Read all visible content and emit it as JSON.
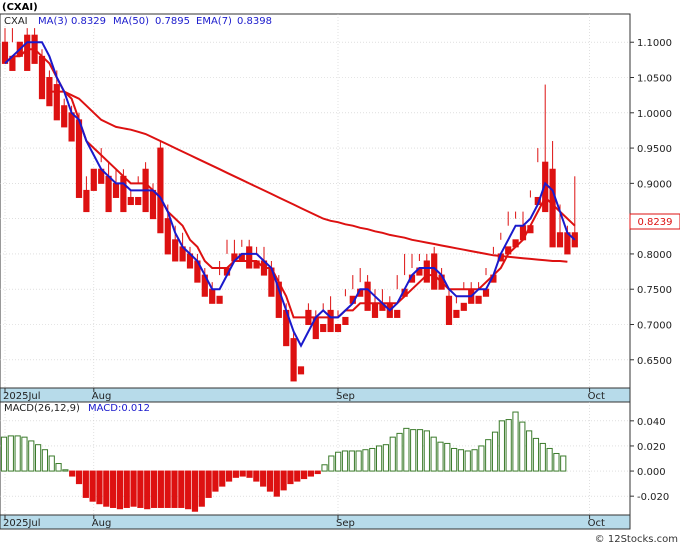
{
  "chart_data": [
    {
      "type": "candlestick",
      "title": "(CXAI)",
      "legend": [
        {
          "label": "CXAI",
          "color": "#222222"
        },
        {
          "label": "MA(3)",
          "value": "0.8329",
          "color": "#1a1acc"
        },
        {
          "label": "MA(50)",
          "value": "0.7895",
          "color": "#1a1acc"
        },
        {
          "label": "EMA(7)",
          "value": "0.8398",
          "color": "#1a1acc"
        }
      ],
      "last_price": "0.8239",
      "ylim": [
        0.61,
        1.14
      ],
      "yticks": [
        {
          "v": 1.1,
          "label": "1.1000"
        },
        {
          "v": 1.05,
          "label": "1.0500"
        },
        {
          "v": 1.0,
          "label": "1.0000"
        },
        {
          "v": 0.95,
          "label": "0.9500"
        },
        {
          "v": 0.9,
          "label": "0.9000"
        },
        {
          "v": 0.85,
          "label": "0.8500"
        },
        {
          "v": 0.8,
          "label": "0.8000"
        },
        {
          "v": 0.75,
          "label": "0.7500"
        },
        {
          "v": 0.7,
          "label": "0.7000"
        },
        {
          "v": 0.65,
          "label": "0.6500"
        }
      ],
      "xlabels": [
        {
          "i": 0,
          "label": "2025Jul"
        },
        {
          "i": 12,
          "label": "Aug"
        },
        {
          "i": 45,
          "label": "Sep"
        },
        {
          "i": 79,
          "label": "Oct"
        }
      ],
      "candles": [
        [
          1.1,
          1.12,
          1.08,
          1.07
        ],
        [
          1.08,
          1.12,
          1.1,
          1.06
        ],
        [
          1.1,
          1.11,
          1.11,
          1.08
        ],
        [
          1.11,
          1.12,
          1.08,
          1.06
        ],
        [
          1.11,
          1.12,
          1.08,
          1.07
        ],
        [
          1.08,
          1.09,
          1.03,
          1.02
        ],
        [
          1.05,
          1.06,
          1.02,
          1.01
        ],
        [
          1.04,
          1.06,
          1.0,
          0.99
        ],
        [
          1.01,
          1.02,
          0.99,
          0.98
        ],
        [
          1.0,
          1.01,
          0.98,
          0.96
        ],
        [
          0.99,
          1.0,
          0.89,
          0.88
        ],
        [
          0.89,
          0.91,
          0.89,
          0.86
        ],
        [
          0.92,
          0.93,
          0.93,
          0.89
        ],
        [
          0.92,
          0.95,
          0.93,
          0.9
        ],
        [
          0.91,
          0.93,
          0.89,
          0.86
        ],
        [
          0.9,
          0.92,
          0.9,
          0.88
        ],
        [
          0.91,
          0.92,
          0.87,
          0.86
        ],
        [
          0.88,
          0.89,
          0.88,
          0.87
        ],
        [
          0.88,
          0.91,
          0.9,
          0.87
        ],
        [
          0.92,
          0.93,
          0.89,
          0.86
        ],
        [
          0.89,
          0.9,
          0.87,
          0.85
        ],
        [
          0.95,
          0.96,
          0.84,
          0.83
        ],
        [
          0.85,
          0.87,
          0.81,
          0.8
        ],
        [
          0.82,
          0.84,
          0.8,
          0.79
        ],
        [
          0.81,
          0.83,
          0.8,
          0.79
        ],
        [
          0.8,
          0.81,
          0.79,
          0.78
        ],
        [
          0.79,
          0.8,
          0.77,
          0.76
        ],
        [
          0.77,
          0.78,
          0.75,
          0.74
        ],
        [
          0.75,
          0.76,
          0.74,
          0.73
        ],
        [
          0.74,
          0.79,
          0.77,
          0.73
        ],
        [
          0.78,
          0.82,
          0.8,
          0.77
        ],
        [
          0.8,
          0.82,
          0.8,
          0.79
        ],
        [
          0.8,
          0.82,
          0.81,
          0.79
        ],
        [
          0.81,
          0.82,
          0.79,
          0.78
        ],
        [
          0.79,
          0.81,
          0.8,
          0.78
        ],
        [
          0.79,
          0.81,
          0.78,
          0.77
        ],
        [
          0.78,
          0.79,
          0.75,
          0.74
        ],
        [
          0.76,
          0.77,
          0.72,
          0.71
        ],
        [
          0.72,
          0.73,
          0.68,
          0.67
        ],
        [
          0.68,
          0.69,
          0.63,
          0.62
        ],
        [
          0.64,
          0.72,
          0.72,
          0.63
        ],
        [
          0.72,
          0.73,
          0.71,
          0.7
        ],
        [
          0.71,
          0.72,
          0.69,
          0.68
        ],
        [
          0.7,
          0.73,
          0.72,
          0.69
        ],
        [
          0.72,
          0.74,
          0.7,
          0.69
        ],
        [
          0.7,
          0.72,
          0.71,
          0.69
        ],
        [
          0.71,
          0.75,
          0.74,
          0.7
        ],
        [
          0.74,
          0.77,
          0.75,
          0.73
        ],
        [
          0.75,
          0.78,
          0.76,
          0.74
        ],
        [
          0.76,
          0.77,
          0.73,
          0.72
        ],
        [
          0.73,
          0.75,
          0.72,
          0.71
        ],
        [
          0.73,
          0.75,
          0.73,
          0.72
        ],
        [
          0.73,
          0.74,
          0.72,
          0.71
        ],
        [
          0.72,
          0.77,
          0.75,
          0.71
        ],
        [
          0.75,
          0.8,
          0.77,
          0.74
        ],
        [
          0.77,
          0.8,
          0.78,
          0.76
        ],
        [
          0.78,
          0.8,
          0.79,
          0.77
        ],
        [
          0.79,
          0.8,
          0.78,
          0.76
        ],
        [
          0.8,
          0.81,
          0.76,
          0.75
        ],
        [
          0.77,
          0.78,
          0.76,
          0.75
        ],
        [
          0.74,
          0.75,
          0.72,
          0.7
        ],
        [
          0.72,
          0.74,
          0.73,
          0.71
        ],
        [
          0.73,
          0.76,
          0.75,
          0.72
        ],
        [
          0.75,
          0.76,
          0.74,
          0.73
        ],
        [
          0.74,
          0.76,
          0.75,
          0.73
        ],
        [
          0.75,
          0.78,
          0.77,
          0.74
        ],
        [
          0.77,
          0.81,
          0.8,
          0.76
        ],
        [
          0.8,
          0.83,
          0.82,
          0.79
        ],
        [
          0.81,
          0.86,
          0.84,
          0.8
        ],
        [
          0.82,
          0.86,
          0.85,
          0.81
        ],
        [
          0.84,
          0.86,
          0.83,
          0.82
        ],
        [
          0.84,
          0.89,
          0.88,
          0.83
        ],
        [
          0.88,
          0.95,
          0.93,
          0.87
        ],
        [
          0.93,
          1.04,
          0.91,
          0.86
        ],
        [
          0.92,
          0.96,
          0.83,
          0.81
        ],
        [
          0.83,
          0.87,
          0.83,
          0.81
        ],
        [
          0.83,
          0.84,
          0.82,
          0.8
        ],
        [
          0.83,
          0.91,
          0.82,
          0.81
        ]
      ],
      "ma3": [
        1.07,
        1.08,
        1.09,
        1.1,
        1.1,
        1.1,
        1.08,
        1.05,
        1.03,
        1.0,
        0.99,
        0.96,
        0.94,
        0.92,
        0.91,
        0.9,
        0.9,
        0.89,
        0.89,
        0.89,
        0.89,
        0.88,
        0.86,
        0.83,
        0.81,
        0.8,
        0.79,
        0.77,
        0.75,
        0.75,
        0.77,
        0.79,
        0.8,
        0.8,
        0.8,
        0.79,
        0.78,
        0.75,
        0.72,
        0.69,
        0.67,
        0.69,
        0.71,
        0.72,
        0.71,
        0.71,
        0.72,
        0.73,
        0.75,
        0.75,
        0.74,
        0.73,
        0.72,
        0.73,
        0.75,
        0.77,
        0.78,
        0.78,
        0.78,
        0.77,
        0.75,
        0.74,
        0.74,
        0.74,
        0.75,
        0.75,
        0.77,
        0.8,
        0.82,
        0.84,
        0.84,
        0.85,
        0.87,
        0.9,
        0.89,
        0.86,
        0.83,
        0.82
      ],
      "ema7": [
        1.07,
        1.08,
        1.08,
        1.09,
        1.09,
        1.08,
        1.07,
        1.05,
        1.03,
        1.02,
        0.99,
        0.96,
        0.95,
        0.94,
        0.93,
        0.92,
        0.91,
        0.9,
        0.9,
        0.9,
        0.89,
        0.88,
        0.86,
        0.85,
        0.84,
        0.82,
        0.81,
        0.79,
        0.78,
        0.78,
        0.78,
        0.79,
        0.79,
        0.79,
        0.79,
        0.78,
        0.78,
        0.76,
        0.74,
        0.71,
        0.71,
        0.71,
        0.71,
        0.71,
        0.71,
        0.71,
        0.72,
        0.72,
        0.73,
        0.73,
        0.73,
        0.73,
        0.73,
        0.73,
        0.74,
        0.75,
        0.76,
        0.77,
        0.77,
        0.76,
        0.75,
        0.75,
        0.75,
        0.75,
        0.75,
        0.76,
        0.77,
        0.78,
        0.8,
        0.81,
        0.82,
        0.84,
        0.86,
        0.88,
        0.87,
        0.86,
        0.85,
        0.84
      ],
      "ma50": [
        1.03,
        1.03,
        1.03,
        1.025,
        1.02,
        1.01,
        1.0,
        0.99,
        0.985,
        0.98,
        0.978,
        0.976,
        0.973,
        0.97,
        0.965,
        0.96,
        0.955,
        0.95,
        0.945,
        0.94,
        0.935,
        0.93,
        0.925,
        0.92,
        0.915,
        0.91,
        0.905,
        0.9,
        0.895,
        0.89,
        0.885,
        0.88,
        0.875,
        0.87,
        0.865,
        0.86,
        0.855,
        0.85,
        0.847,
        0.845,
        0.842,
        0.84,
        0.837,
        0.835,
        0.832,
        0.83,
        0.827,
        0.825,
        0.823,
        0.82,
        0.818,
        0.816,
        0.814,
        0.812,
        0.81,
        0.808,
        0.806,
        0.804,
        0.802,
        0.8,
        0.798,
        0.797,
        0.796,
        0.795,
        0.794,
        0.793,
        0.792,
        0.791,
        0.79,
        0.79,
        0.789
      ],
      "ma50_offset": 7
    },
    {
      "type": "bar",
      "title": "MACD(26,12,9)",
      "legend": [
        {
          "label": "MACD(26,12,9)",
          "color": "#222222"
        },
        {
          "label": "MACD:0.012",
          "color": "#1a1acc"
        }
      ],
      "ylim": [
        -0.035,
        0.055
      ],
      "yticks": [
        {
          "v": 0.04,
          "label": "0.040"
        },
        {
          "v": 0.02,
          "label": "0.020"
        },
        {
          "v": 0.0,
          "label": "0.000"
        },
        {
          "v": -0.02,
          "label": "-0.020"
        }
      ],
      "xlabels": [
        {
          "i": 0,
          "label": "2025Jul"
        },
        {
          "i": 12,
          "label": "Aug"
        },
        {
          "i": 45,
          "label": "Sep"
        },
        {
          "i": 79,
          "label": "Oct"
        }
      ],
      "values": [
        0.027,
        0.028,
        0.028,
        0.027,
        0.024,
        0.021,
        0.017,
        0.012,
        0.006,
        0.001,
        -0.004,
        -0.01,
        -0.021,
        -0.024,
        -0.026,
        -0.028,
        -0.029,
        -0.03,
        -0.029,
        -0.028,
        -0.029,
        -0.03,
        -0.029,
        -0.029,
        -0.029,
        -0.029,
        -0.029,
        -0.03,
        -0.032,
        -0.028,
        -0.021,
        -0.016,
        -0.012,
        -0.008,
        -0.005,
        -0.004,
        -0.005,
        -0.008,
        -0.012,
        -0.016,
        -0.02,
        -0.015,
        -0.01,
        -0.008,
        -0.006,
        -0.004,
        -0.002,
        0.005,
        0.012,
        0.015,
        0.016,
        0.016,
        0.016,
        0.017,
        0.018,
        0.02,
        0.021,
        0.027,
        0.03,
        0.034,
        0.033,
        0.033,
        0.032,
        0.027,
        0.023,
        0.022,
        0.018,
        0.017,
        0.016,
        0.017,
        0.02,
        0.025,
        0.031,
        0.04,
        0.041,
        0.047,
        0.039,
        0.032,
        0.026,
        0.022,
        0.018,
        0.014,
        0.012
      ],
      "colors": "green when value >= 0, red when value < 0"
    }
  ],
  "footer": {
    "credit": "© 12Stocks.com"
  },
  "colors": {
    "up": "#3a7a2a",
    "down": "#dd1111",
    "ma_blue": "#1a1acc",
    "ma_red": "#dd1111",
    "axisbar": "#b7dbea",
    "grid": "#cccccc"
  }
}
